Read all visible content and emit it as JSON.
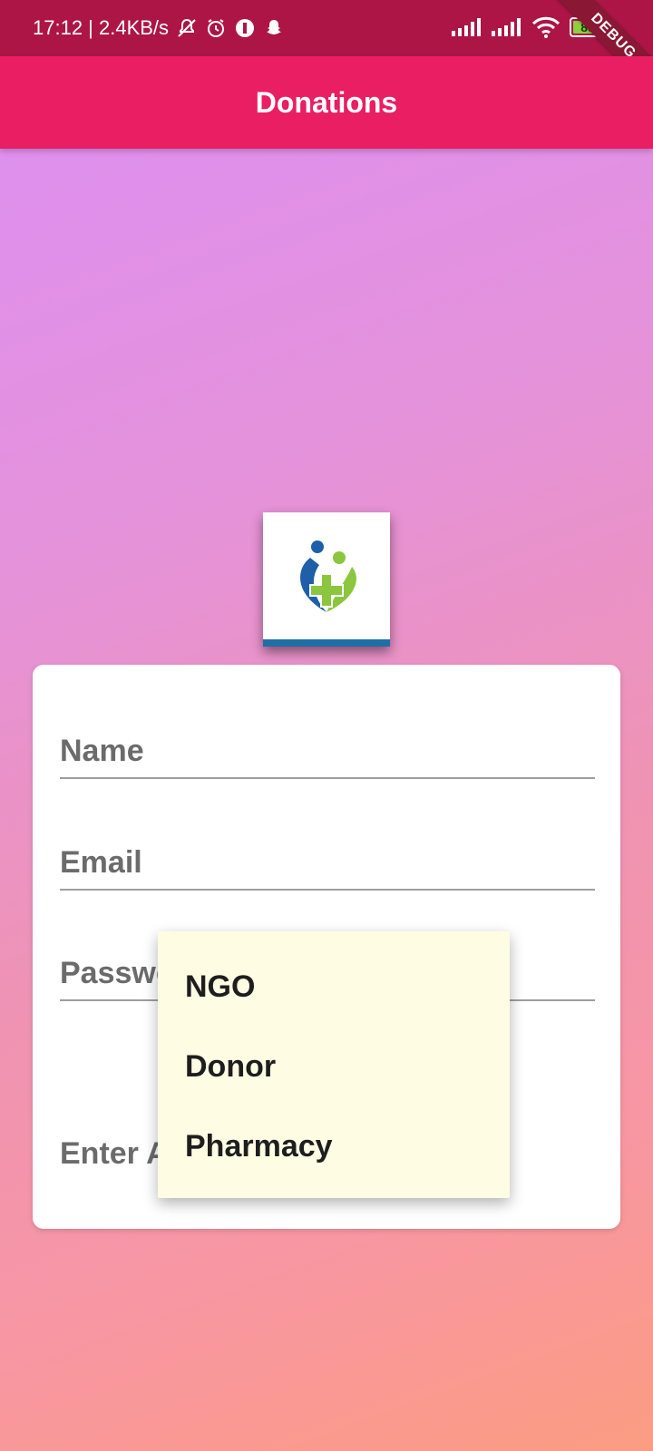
{
  "status_bar": {
    "time_speed": "17:12 | 2.4KB/s",
    "battery": "89",
    "icons": [
      "mute-icon",
      "alarm-icon",
      "app-icon",
      "snapchat-icon",
      "signal-icon",
      "signal-icon-2",
      "wifi-icon",
      "battery-icon"
    ]
  },
  "debug_ribbon": "DEBUG",
  "app_bar": {
    "title": "Donations"
  },
  "form": {
    "name_label": "Name",
    "email_label": "Email",
    "password_label": "Password",
    "role_label": "Enter A"
  },
  "dropdown": {
    "items": [
      "NGO",
      "Donor",
      "Pharmacy"
    ]
  },
  "colors": {
    "status_bar": "#ad1547",
    "app_bar": "#e91e63",
    "menu_bg": "#fffce4",
    "logo_blue": "#1f5ea8",
    "logo_green": "#8cc63f"
  }
}
